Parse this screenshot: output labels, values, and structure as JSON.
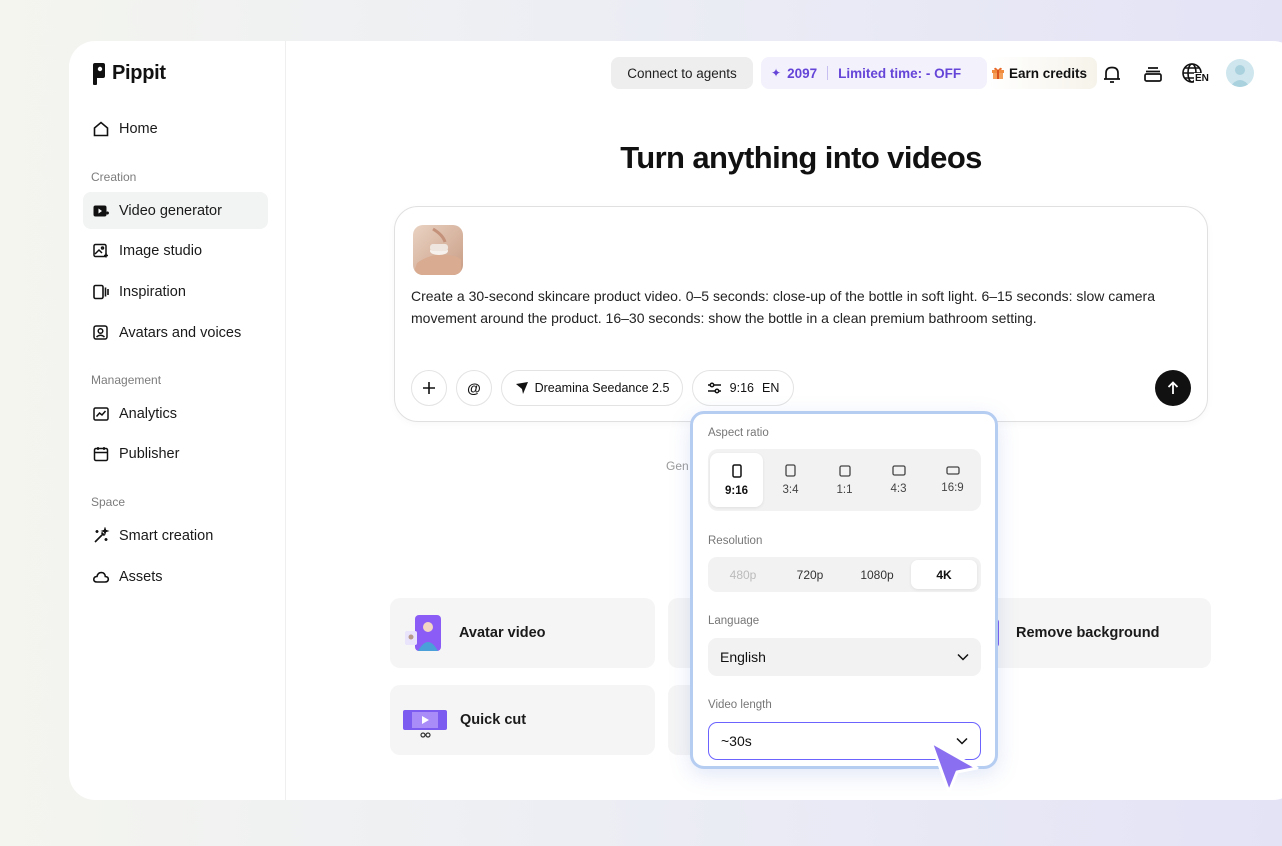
{
  "app": {
    "name": "Pippit"
  },
  "sidebar": {
    "home": "Home",
    "sections": {
      "creation": "Creation",
      "management": "Management",
      "space": "Space"
    },
    "items": [
      {
        "label": "Video generator",
        "icon": "video-plus-icon",
        "active": true
      },
      {
        "label": "Image studio",
        "icon": "image-plus-icon"
      },
      {
        "label": "Inspiration",
        "icon": "inspiration-icon"
      },
      {
        "label": "Avatars and voices",
        "icon": "avatar-icon"
      },
      {
        "label": "Analytics",
        "icon": "analytics-icon"
      },
      {
        "label": "Publisher",
        "icon": "calendar-icon"
      },
      {
        "label": "Smart creation",
        "icon": "magic-wand-icon"
      },
      {
        "label": "Assets",
        "icon": "cloud-icon"
      }
    ]
  },
  "header": {
    "connect_label": "Connect to agents",
    "credits_value": "2097",
    "promo_text": "Limited time: - OFF",
    "earn_label": "Earn credits",
    "lang_badge": "EN"
  },
  "main": {
    "title": "Turn anything into videos",
    "prompt": "Create a 30-second skincare product video. 0–5 seconds: close-up of the bottle in soft light. 6–15 seconds: slow camera movement around the product. 16–30 seconds: show the bottle in a clean premium bathroom setting.",
    "model_label": "Dreamina Seedance 2.5",
    "settings_ratio": "9:16",
    "settings_lang": "EN",
    "gen_note": "Gen",
    "tiles": {
      "avatar_video": "Avatar video",
      "remove_background": "Remove background",
      "quick_cut": "Quick cut"
    }
  },
  "popover": {
    "aspect_label": "Aspect ratio",
    "ratios": [
      "9:16",
      "3:4",
      "1:1",
      "4:3",
      "16:9"
    ],
    "selected_ratio": "9:16",
    "resolution_label": "Resolution",
    "resolutions": [
      "480p",
      "720p",
      "1080p",
      "4K"
    ],
    "selected_resolution": "4K",
    "language_label": "Language",
    "language_value": "English",
    "length_label": "Video length",
    "length_value": "~30s"
  },
  "colors": {
    "accent": "#6545d8",
    "popover_border": "#b6cdf2",
    "focus_border": "#6c63ff",
    "cursor": "#8a6ff0"
  }
}
